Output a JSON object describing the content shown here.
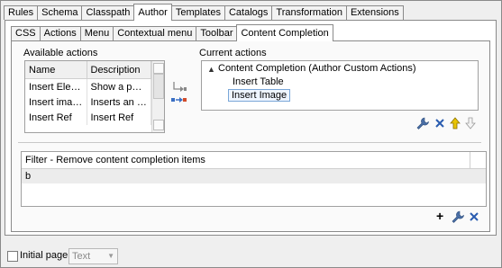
{
  "top_tabs": [
    "Rules",
    "Schema",
    "Classpath",
    "Author",
    "Templates",
    "Catalogs",
    "Transformation",
    "Extensions"
  ],
  "top_tab_selected": "Author",
  "sub_tabs": [
    "CSS",
    "Actions",
    "Menu",
    "Contextual menu",
    "Toolbar",
    "Content Completion"
  ],
  "sub_tab_selected": "Content Completion",
  "available": {
    "label": "Available actions",
    "columns": [
      "Name",
      "Description"
    ],
    "rows": [
      [
        "Insert Element",
        "Show a pop..."
      ],
      [
        "Insert image",
        "Inserts an i..."
      ],
      [
        "Insert Ref",
        "Insert Ref"
      ]
    ]
  },
  "current": {
    "label": "Current actions",
    "root": "Content Completion (Author Custom Actions)",
    "items": [
      "Insert Table",
      "Insert Image"
    ],
    "selected_item": "Insert Image"
  },
  "filter": {
    "header": "Filter - Remove content completion items",
    "rows": [
      "b"
    ]
  },
  "bottom": {
    "initial_page_label": "Initial page",
    "initial_page_checked": false,
    "combo_value": "Text"
  },
  "colors": {
    "selection_border": "#7aa7d8",
    "delete": "#2a5cb0",
    "move": "#d8b000"
  }
}
